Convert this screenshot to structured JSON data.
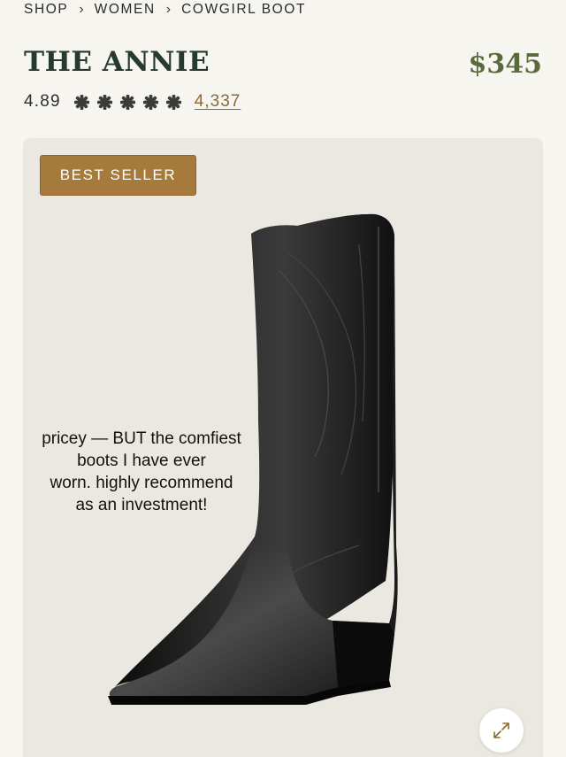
{
  "breadcrumb": [
    "SHOP",
    "WOMEN",
    "COWGIRL BOOT"
  ],
  "product": {
    "title": "THE ANNIE",
    "price": "$345",
    "rating": "4.89",
    "rating_stars": 5,
    "review_count": "4,337",
    "badge": "BEST SELLER"
  },
  "review_overlay": {
    "line1": "pricey — BUT the comfiest",
    "line2": "boots I have ever",
    "line3": "worn. highly recommend",
    "line4": "as an investment!"
  },
  "colors": {
    "background": "#f7f5f0",
    "title": "#263a30",
    "price": "#596b3c",
    "badge": "#a57a3b",
    "link": "#8a6a2f"
  },
  "icons": {
    "breadcrumb_separator": "chevron-right-icon",
    "rating": "star-icon",
    "expand": "expand-icon"
  }
}
